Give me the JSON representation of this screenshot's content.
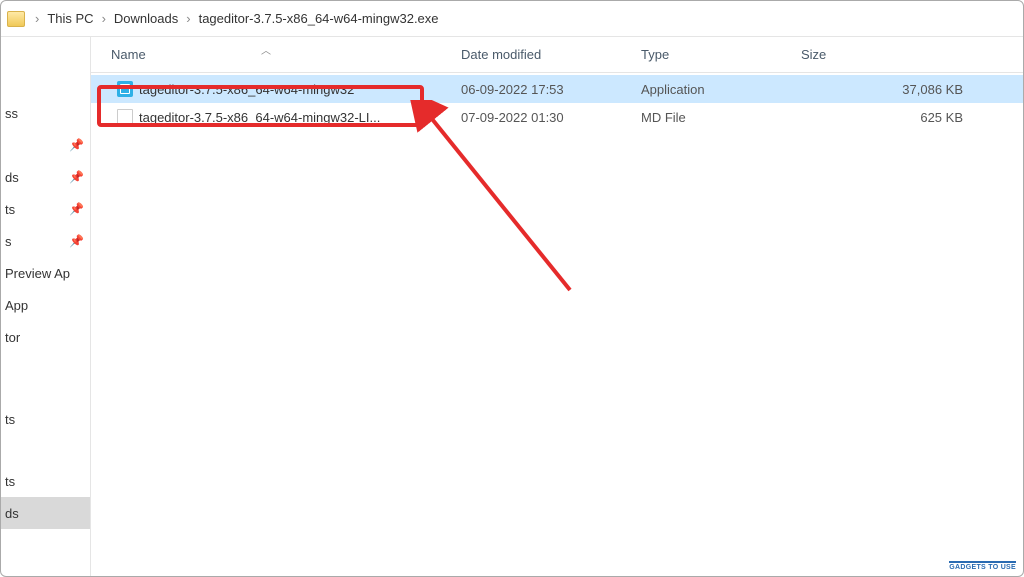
{
  "breadcrumbs": {
    "items": [
      "This PC",
      "Downloads",
      "tageditor-3.7.5-x86_64-w64-mingw32.exe"
    ]
  },
  "sidebar": {
    "items": [
      {
        "label": "ss",
        "pinned": true
      },
      {
        "label": "ds",
        "pinned": true
      },
      {
        "label": "ts",
        "pinned": true
      },
      {
        "label": "s",
        "pinned": true
      },
      {
        "label": "Preview Ap",
        "pinned": false
      },
      {
        "label": "App",
        "pinned": false
      },
      {
        "label": "tor",
        "pinned": false
      },
      {
        "label": "",
        "pinned": false
      },
      {
        "label": "ts",
        "pinned": false
      },
      {
        "label": "",
        "pinned": false
      },
      {
        "label": "ts",
        "pinned": false
      },
      {
        "label": "ds",
        "pinned": false,
        "selected": true
      }
    ]
  },
  "columns": {
    "name": "Name",
    "date": "Date modified",
    "type": "Type",
    "size": "Size"
  },
  "files": [
    {
      "name": "tageditor-3.7.5-x86_64-w64-mingw32",
      "date": "06-09-2022 17:53",
      "type": "Application",
      "size": "37,086 KB",
      "icon": "exe",
      "selected": true
    },
    {
      "name": "tageditor-3.7.5-x86_64-w64-mingw32-LI...",
      "date": "07-09-2022 01:30",
      "type": "MD File",
      "size": "625 KB",
      "icon": "md",
      "selected": false
    }
  ],
  "watermark": "GADGETS TO USE"
}
